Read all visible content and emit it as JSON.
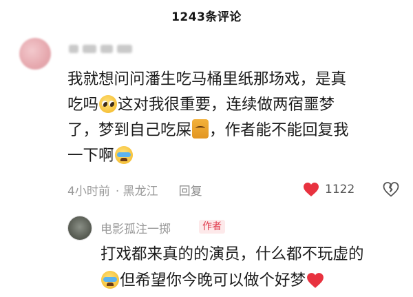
{
  "header": {
    "title": "1243条评论"
  },
  "comment": {
    "lines": {
      "l1": "我就想问问潘生吃马桶里纸那场戏，是真",
      "l2a": "吃吗",
      "l2b": "这对我很重要，连续做两宿噩梦",
      "l3a": "了，梦到自己吃屎",
      "l3b": "，作者能不能回复我",
      "l4a": "一下啊"
    },
    "time": "4小时前",
    "location": "· 黑龙江",
    "reply_label": "回复",
    "like_count": "1122"
  },
  "reply": {
    "name": "电影孤注一掷",
    "badge": "作者",
    "lines": {
      "l1": "打戏都来真的的演员，什么都不玩虚的",
      "l2": "但希望你今晚可以做个好梦"
    }
  },
  "icons": {
    "emoji_1": "pleading-face-emoji",
    "emoji_2": "cat-emoji",
    "emoji_3": "crying-face-emoji",
    "emoji_4": "crying-face-emoji",
    "emoji_5": "heart-emoji",
    "like": "heart-icon",
    "dislike": "broken-heart-icon"
  },
  "colors": {
    "like": "#e8323f",
    "badge_text": "#e0384a",
    "badge_bg": "#fde9ea",
    "meta": "#9a9a9a"
  }
}
